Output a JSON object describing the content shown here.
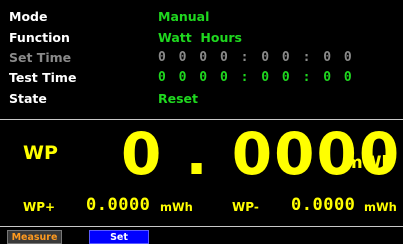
{
  "info": {
    "mode": {
      "label": "Mode",
      "value": "Manual"
    },
    "function": {
      "label": "Function",
      "value": "Watt  Hours"
    },
    "set_time": {
      "label": "Set  Time",
      "value": "0 0 0 0 : 0 0 : 0 0"
    },
    "test_time": {
      "label": "Test  Time",
      "value": "0 0 0 0 : 0 0 : 0 0"
    },
    "state": {
      "label": "State",
      "value": "Reset"
    }
  },
  "measurement": {
    "main_label": "WP",
    "main_value": "0 . 0000",
    "main_unit": "mWh",
    "plus_label": "WP+",
    "plus_value": "0.0000",
    "plus_unit": "mWh",
    "minus_label": "WP-",
    "minus_value": "0.0000",
    "minus_unit": "mWh"
  },
  "tabs": {
    "measure": "Measure",
    "set": "Set"
  },
  "colors": {
    "value_green": "#1fd81f",
    "reading_yellow": "#ffff00",
    "dim_gray": "#8a8a8a",
    "set_tab_blue": "#0000ff",
    "measure_tab_orange": "#ff9a1f"
  }
}
